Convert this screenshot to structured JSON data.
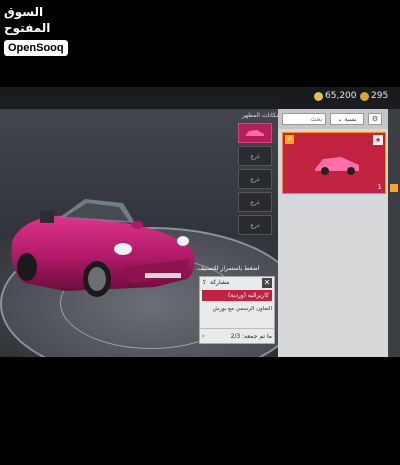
{
  "watermark": {
    "arabic": "السوق المفتوح",
    "latin": "OpenSooq"
  },
  "topbar": {
    "coins": "65,200",
    "uc": "295"
  },
  "panel": {
    "appearance_label": "إمكانات المظهر",
    "search_placeholder": "بحث",
    "sort_label": "نسبة",
    "item": {
      "count": "1"
    }
  },
  "slots": [
    "",
    "ذرع",
    "ذرع",
    "ذرع",
    "ذرع"
  ],
  "popup": {
    "hint": "اضغط باستمرار للتصنيف.",
    "share_label": "مشاركة",
    "item_name": "كاريراليه (وردية)",
    "description": "التعاون الرسمي مع بورش",
    "footer_label": "ما تم جمعه:",
    "footer_count": "2/3"
  },
  "colors": {
    "accent": "#c0223f",
    "highlight": "#f5a623"
  }
}
